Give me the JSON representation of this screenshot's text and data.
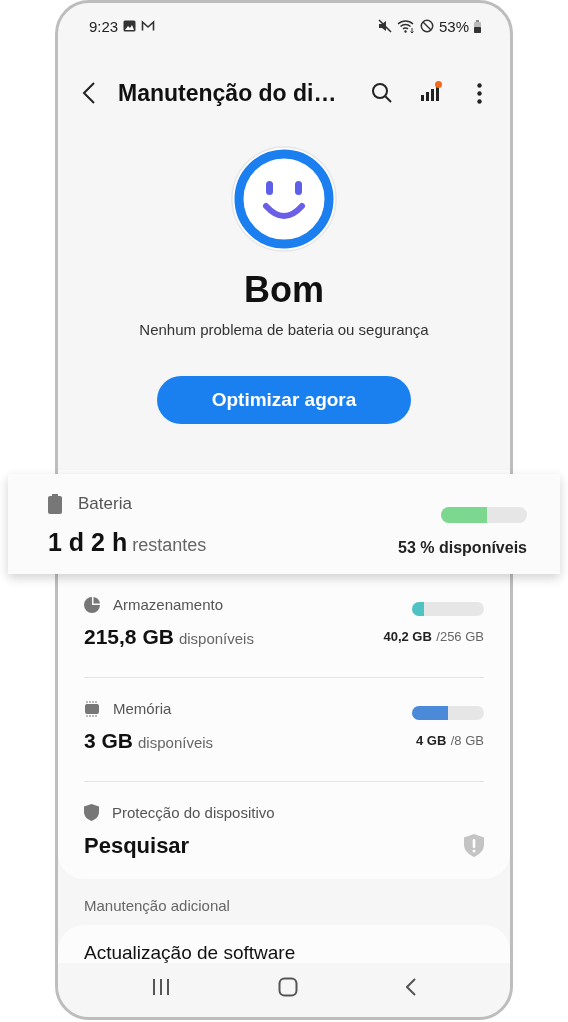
{
  "status_bar": {
    "time": "9:23",
    "battery_percent": "53%"
  },
  "header": {
    "title": "Manutenção do di…",
    "badge": true
  },
  "summary": {
    "status": "Bom",
    "message": "Nenhum problema de bateria ou segurança",
    "button": "Optimizar agora"
  },
  "metrics": [
    {
      "kind": "battery",
      "label": "Bateria",
      "value": "1 d 2 h",
      "unit": "restantes",
      "level": 0.53,
      "color": "#7dd88f",
      "reading": "53 % disponíveis",
      "raised": true
    },
    {
      "kind": "storage",
      "label": "Armazenamento",
      "value": "215,8 GB",
      "unit": "disponíveis",
      "level": 0.16,
      "color": "#4fc3c3",
      "used": "40,2 GB",
      "total": "/256 GB",
      "raised": false
    },
    {
      "kind": "memory",
      "label": "Memória",
      "value": "3 GB",
      "unit": "disponíveis",
      "level": 0.5,
      "color": "#4a8ad8",
      "used": "4 GB",
      "total": "/8 GB",
      "raised": false
    },
    {
      "kind": "protection",
      "label": "Protecção do dispositivo",
      "value": "Pesquisar",
      "raised": false
    }
  ],
  "additional": {
    "heading": "Manutenção adicional",
    "items": [
      "Actualização de software"
    ]
  }
}
